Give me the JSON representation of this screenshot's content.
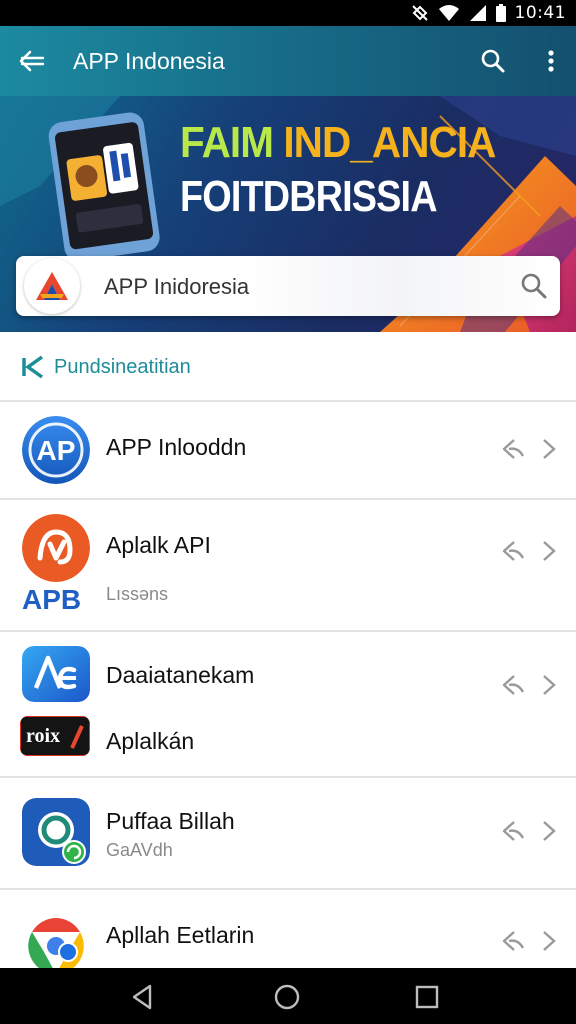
{
  "status_bar": {
    "time": "10:41"
  },
  "app_bar": {
    "title": "APP Indonesia",
    "icons": [
      "back-arrow-icon",
      "search-icon",
      "more-vert-icon"
    ]
  },
  "banner": {
    "headline_word1": "FAIM",
    "headline_word2": "IND_ANCIA",
    "headline_line2": "FOITDBRISSIA",
    "search_text": "APP Inidoresia",
    "colors": {
      "green": "#b9e84a",
      "orange": "#f5b21c",
      "navy": "#1a2d63"
    }
  },
  "section": {
    "title": "Pundsineatitian",
    "accent": "#1d8d98"
  },
  "items": [
    {
      "title": "APP Inlooddn",
      "subtitle": "",
      "icon": "app-ap-icon"
    },
    {
      "title": "Aplalk API",
      "subtitle": "Lıssəns",
      "icon": "app-orange-icon",
      "badge_text": "APB"
    },
    {
      "title": "Daaiatanekam",
      "title2": "Aplalkán",
      "icon": "app-ae-icon",
      "secondary_icon_text": "roix"
    },
    {
      "title": "Puffaa Billah",
      "subtitle": "GaAVdh",
      "icon": "app-blue-circle-icon"
    },
    {
      "title": "Apllah Eetlarin",
      "subtitle": "",
      "icon": "app-chrome-icon"
    }
  ],
  "nav_bar": {
    "icons": [
      "back-triangle-icon",
      "home-circle-icon",
      "recents-square-icon"
    ]
  }
}
